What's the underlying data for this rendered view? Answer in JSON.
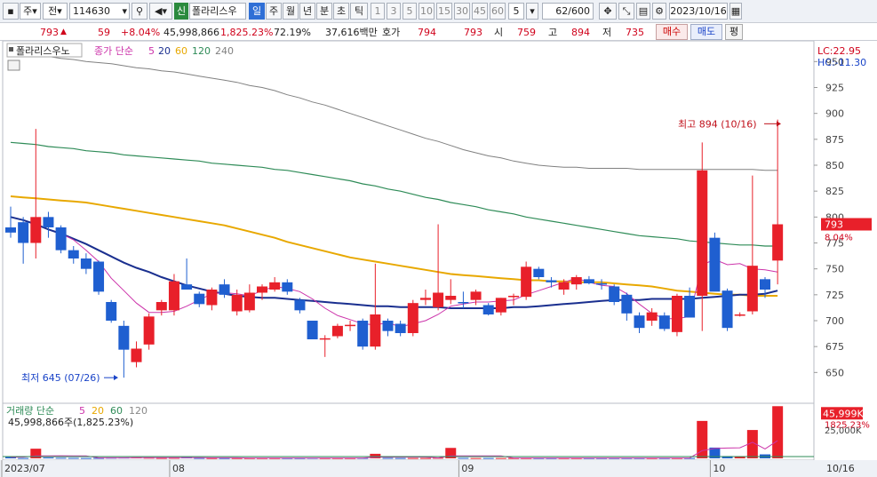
{
  "toolbar": {
    "period_unit": "주",
    "scope": "전",
    "code": "114630",
    "badge": "신",
    "name": "폴라리스우",
    "periods": [
      "일",
      "주",
      "월",
      "년",
      "분",
      "초",
      "틱"
    ],
    "intervals": [
      "1",
      "3",
      "5",
      "10",
      "15",
      "30",
      "45",
      "60"
    ],
    "count": "5",
    "bars": "62/600",
    "date": "2023/10/16"
  },
  "quote": {
    "price": "793",
    "change": "59",
    "change_pct": "+8.04%",
    "volume": "45,998,866",
    "volume_ratio": "1,825.23%",
    "turnover": "72.19%",
    "amount": "37,616백만",
    "ask_label": "호가",
    "ask": "794",
    "bid": "793",
    "open_label": "시",
    "open": "759",
    "high_label": "고",
    "high": "894",
    "low_label": "저",
    "low": "735",
    "buy_label": "매수",
    "sell_label": "매도",
    "eval_label": "평"
  },
  "legend": {
    "title": "폴라리스우노",
    "price_label": "종가 단순",
    "ma_periods": [
      "5",
      "20",
      "60",
      "120",
      "240"
    ],
    "volume_label": "거래량 단순",
    "vol_ma_periods": [
      "5",
      "20",
      "60",
      "120"
    ],
    "volume_readout": "45,998,866주(1,825.23%)"
  },
  "indicators": {
    "lc": "LC:22.95",
    "hc": "HC:-11.30"
  },
  "annotations": {
    "high": "최고 894 (10/16)",
    "low": "최저 645 (07/26)"
  },
  "price_tag": {
    "price": "793",
    "pct": "8.04%"
  },
  "volume_tag": {
    "value": "45,999K",
    "pct": "1825.23%",
    "axis_25k": "25,000K"
  },
  "colors": {
    "up": "#e8202a",
    "down": "#1f5fd0",
    "ma5": "#cc33aa",
    "ma20": "#1a2f8f",
    "ma60": "#e8a800",
    "ma120": "#2e8b57",
    "ma240": "#808080"
  },
  "chart_data": {
    "type": "candlestick",
    "title": "폴라리스우노",
    "ylim": [
      622,
      958
    ],
    "y_ticks": [
      650,
      675,
      700,
      725,
      750,
      775,
      800,
      825,
      850,
      875,
      900,
      925,
      950
    ],
    "date_labels": [
      {
        "label": "2023/07",
        "index": 0
      },
      {
        "label": "08",
        "index": 13
      },
      {
        "label": "09",
        "index": 36
      },
      {
        "label": "10",
        "index": 56
      },
      {
        "label": "10/16",
        "index": 62
      }
    ],
    "candles": [
      {
        "o": 790,
        "h": 810,
        "l": 780,
        "c": 785
      },
      {
        "o": 795,
        "h": 800,
        "l": 755,
        "c": 775
      },
      {
        "o": 775,
        "h": 885,
        "l": 760,
        "c": 800
      },
      {
        "o": 800,
        "h": 805,
        "l": 780,
        "c": 790
      },
      {
        "o": 790,
        "h": 792,
        "l": 765,
        "c": 768
      },
      {
        "o": 768,
        "h": 772,
        "l": 755,
        "c": 760
      },
      {
        "o": 760,
        "h": 765,
        "l": 745,
        "c": 750
      },
      {
        "o": 757,
        "h": 758,
        "l": 725,
        "c": 728
      },
      {
        "o": 718,
        "h": 720,
        "l": 698,
        "c": 700
      },
      {
        "o": 695,
        "h": 700,
        "l": 645,
        "c": 672
      },
      {
        "o": 660,
        "h": 680,
        "l": 655,
        "c": 673
      },
      {
        "o": 677,
        "h": 707,
        "l": 672,
        "c": 704
      },
      {
        "o": 710,
        "h": 720,
        "l": 705,
        "c": 718
      },
      {
        "o": 710,
        "h": 745,
        "l": 705,
        "c": 738
      },
      {
        "o": 735,
        "h": 760,
        "l": 730,
        "c": 730
      },
      {
        "o": 726,
        "h": 728,
        "l": 713,
        "c": 716
      },
      {
        "o": 715,
        "h": 732,
        "l": 710,
        "c": 730
      },
      {
        "o": 735,
        "h": 740,
        "l": 722,
        "c": 725
      },
      {
        "o": 709,
        "h": 730,
        "l": 705,
        "c": 725
      },
      {
        "o": 710,
        "h": 735,
        "l": 708,
        "c": 727
      },
      {
        "o": 727,
        "h": 735,
        "l": 720,
        "c": 733
      },
      {
        "o": 730,
        "h": 742,
        "l": 728,
        "c": 737
      },
      {
        "o": 737,
        "h": 740,
        "l": 725,
        "c": 728
      },
      {
        "o": 720,
        "h": 722,
        "l": 707,
        "c": 710
      },
      {
        "o": 700,
        "h": 700,
        "l": 682,
        "c": 682
      },
      {
        "o": 683,
        "h": 686,
        "l": 665,
        "c": 683
      },
      {
        "o": 685,
        "h": 697,
        "l": 683,
        "c": 695
      },
      {
        "o": 695,
        "h": 700,
        "l": 690,
        "c": 696
      },
      {
        "o": 700,
        "h": 702,
        "l": 672,
        "c": 675
      },
      {
        "o": 675,
        "h": 755,
        "l": 672,
        "c": 706
      },
      {
        "o": 700,
        "h": 702,
        "l": 685,
        "c": 690
      },
      {
        "o": 697,
        "h": 700,
        "l": 685,
        "c": 688
      },
      {
        "o": 688,
        "h": 720,
        "l": 685,
        "c": 717
      },
      {
        "o": 720,
        "h": 730,
        "l": 715,
        "c": 722
      },
      {
        "o": 713,
        "h": 793,
        "l": 710,
        "c": 727
      },
      {
        "o": 720,
        "h": 740,
        "l": 716,
        "c": 724
      },
      {
        "o": 718,
        "h": 728,
        "l": 712,
        "c": 717
      },
      {
        "o": 720,
        "h": 730,
        "l": 715,
        "c": 728
      },
      {
        "o": 715,
        "h": 717,
        "l": 705,
        "c": 706
      },
      {
        "o": 708,
        "h": 722,
        "l": 705,
        "c": 722
      },
      {
        "o": 724,
        "h": 726,
        "l": 715,
        "c": 724
      },
      {
        "o": 723,
        "h": 757,
        "l": 720,
        "c": 752
      },
      {
        "o": 750,
        "h": 752,
        "l": 740,
        "c": 742
      },
      {
        "o": 739,
        "h": 742,
        "l": 732,
        "c": 737
      },
      {
        "o": 730,
        "h": 740,
        "l": 725,
        "c": 737
      },
      {
        "o": 735,
        "h": 744,
        "l": 730,
        "c": 742
      },
      {
        "o": 740,
        "h": 743,
        "l": 735,
        "c": 736
      },
      {
        "o": 736,
        "h": 740,
        "l": 730,
        "c": 735
      },
      {
        "o": 733,
        "h": 735,
        "l": 715,
        "c": 718
      },
      {
        "o": 725,
        "h": 727,
        "l": 700,
        "c": 707
      },
      {
        "o": 705,
        "h": 708,
        "l": 688,
        "c": 693
      },
      {
        "o": 700,
        "h": 712,
        "l": 695,
        "c": 708
      },
      {
        "o": 705,
        "h": 708,
        "l": 690,
        "c": 692
      },
      {
        "o": 689,
        "h": 726,
        "l": 685,
        "c": 724
      },
      {
        "o": 724,
        "h": 732,
        "l": 705,
        "c": 703
      },
      {
        "o": 724,
        "h": 872,
        "l": 690,
        "c": 845
      },
      {
        "o": 780,
        "h": 785,
        "l": 730,
        "c": 728
      },
      {
        "o": 729,
        "h": 731,
        "l": 690,
        "c": 693
      },
      {
        "o": 706,
        "h": 708,
        "l": 704,
        "c": 706
      },
      {
        "o": 709,
        "h": 840,
        "l": 706,
        "c": 753
      },
      {
        "o": 740,
        "h": 742,
        "l": 722,
        "c": 730
      },
      {
        "o": 758,
        "h": 894,
        "l": 735,
        "c": 793
      }
    ],
    "moving_averages": [
      {
        "name": "5",
        "values": [
          null,
          null,
          null,
          null,
          784,
          778,
          768,
          757,
          741,
          729,
          717,
          708,
          708,
          709,
          714,
          720,
          726,
          727,
          726,
          724,
          729,
          733,
          731,
          728,
          721,
          712,
          705,
          701,
          697,
          696,
          698,
          694,
          697,
          700,
          706,
          714,
          716,
          718,
          718,
          719,
          720,
          725,
          729,
          733,
          737,
          741,
          737,
          734,
          733,
          726,
          716,
          707,
          702,
          702,
          704,
          754,
          759,
          754,
          755,
          750,
          749,
          747
        ]
      },
      {
        "name": "20",
        "values": [
          800,
          797,
          793,
          788,
          784,
          779,
          774,
          768,
          762,
          756,
          751,
          747,
          742,
          738,
          734,
          731,
          728,
          726,
          724,
          723,
          722,
          722,
          721,
          720,
          719,
          718,
          717,
          716,
          715,
          714,
          714,
          713,
          713,
          713,
          713,
          712,
          712,
          712,
          712,
          712,
          713,
          713,
          714,
          715,
          716,
          717,
          718,
          719,
          720,
          720,
          720,
          721,
          721,
          721,
          721,
          722,
          723,
          724,
          725,
          725,
          726,
          729
        ]
      },
      {
        "name": "60",
        "values": [
          820,
          819,
          818,
          817,
          816,
          815,
          814,
          812,
          810,
          808,
          806,
          804,
          802,
          800,
          798,
          796,
          794,
          792,
          789,
          786,
          783,
          780,
          776,
          773,
          770,
          767,
          764,
          761,
          759,
          757,
          755,
          753,
          751,
          749,
          747,
          745,
          744,
          743,
          742,
          741,
          740,
          739,
          739,
          738,
          738,
          737,
          737,
          737,
          736,
          735,
          734,
          733,
          731,
          729,
          728,
          727,
          726,
          725,
          725,
          724,
          724,
          724
        ]
      },
      {
        "name": "120",
        "values": [
          872,
          871,
          870,
          868,
          867,
          866,
          864,
          863,
          862,
          860,
          859,
          858,
          857,
          856,
          855,
          854,
          852,
          851,
          850,
          849,
          848,
          846,
          845,
          843,
          841,
          839,
          837,
          835,
          832,
          830,
          827,
          825,
          822,
          819,
          817,
          814,
          812,
          810,
          807,
          805,
          803,
          800,
          798,
          796,
          794,
          792,
          790,
          788,
          786,
          784,
          782,
          781,
          780,
          779,
          777,
          776,
          775,
          774,
          773,
          773,
          772,
          772
        ]
      },
      {
        "name": "240",
        "values": [
          960,
          958,
          957,
          955,
          953,
          952,
          950,
          949,
          948,
          946,
          944,
          943,
          941,
          940,
          938,
          936,
          934,
          932,
          930,
          927,
          925,
          922,
          918,
          915,
          911,
          908,
          904,
          900,
          896,
          892,
          888,
          884,
          880,
          876,
          873,
          869,
          865,
          862,
          859,
          857,
          854,
          852,
          850,
          849,
          848,
          848,
          847,
          847,
          847,
          847,
          846,
          846,
          846,
          846,
          846,
          846,
          846,
          846,
          846,
          846,
          845,
          845
        ]
      }
    ],
    "volume": {
      "ylim": [
        0,
        47000000
      ],
      "values": [
        1100000,
        300000,
        8500000,
        800000,
        500000,
        400000,
        300000,
        400000,
        600000,
        700000,
        800000,
        600000,
        400000,
        500000,
        900000,
        400000,
        300000,
        300000,
        300000,
        300000,
        300000,
        300000,
        300000,
        300000,
        400000,
        300000,
        300000,
        300000,
        400000,
        4000000,
        400000,
        300000,
        300000,
        300000,
        500000,
        9200000,
        400000,
        300000,
        300000,
        300000,
        300000,
        300000,
        300000,
        300000,
        300000,
        300000,
        300000,
        300000,
        300000,
        300000,
        300000,
        300000,
        300000,
        300000,
        300000,
        33000000,
        9500000,
        2000000,
        1500000,
        25000000,
        3500000,
        45998866
      ],
      "ma5": [
        1100000,
        1100000,
        2200000,
        2200000,
        2240000,
        2100000,
        2100000,
        500000,
        440000,
        480000,
        560000,
        600000,
        620000,
        600000,
        640000,
        560000,
        500000,
        480000,
        440000,
        320000,
        300000,
        300000,
        300000,
        300000,
        320000,
        320000,
        320000,
        320000,
        340000,
        1060000,
        1080000,
        1080000,
        1080000,
        1080000,
        360000,
        2100000,
        2140000,
        2140000,
        2140000,
        2100000,
        320000,
        300000,
        300000,
        300000,
        300000,
        300000,
        300000,
        300000,
        300000,
        300000,
        300000,
        300000,
        300000,
        300000,
        300000,
        6840000,
        8660000,
        9060000,
        9360000,
        14200000,
        8300000,
        15600000
      ]
    }
  }
}
